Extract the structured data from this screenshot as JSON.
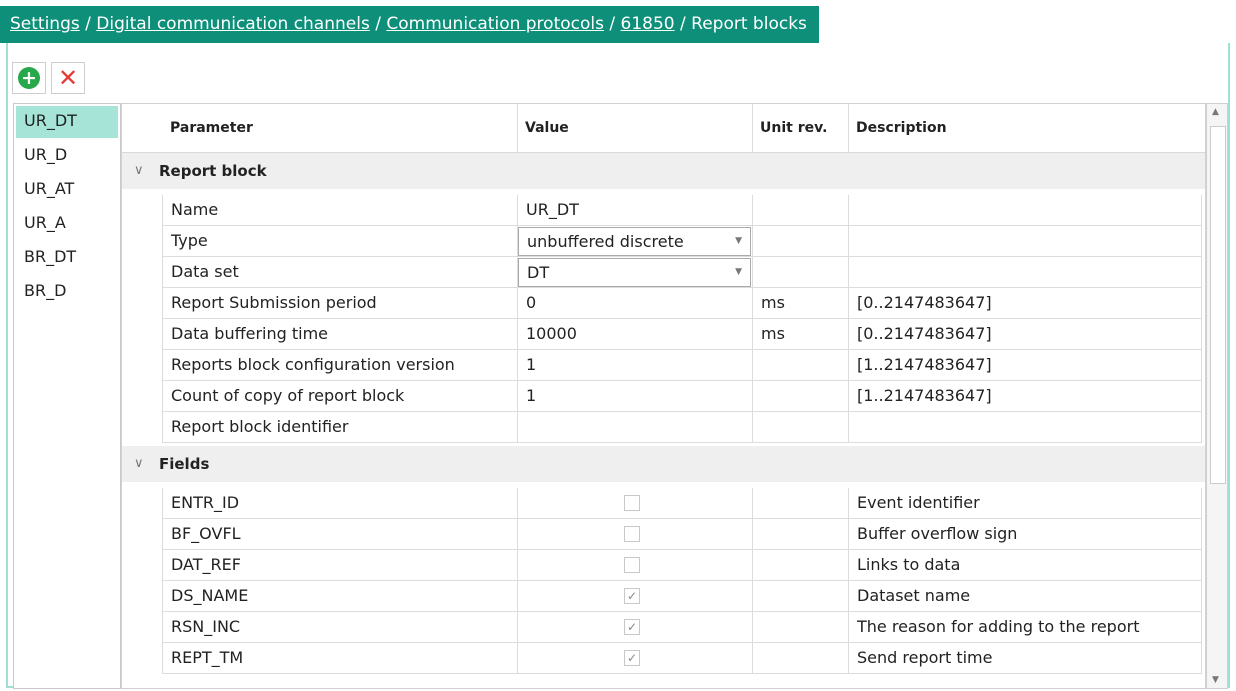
{
  "breadcrumb": {
    "items": [
      "Settings",
      "Digital communication channels",
      "Communication protocols",
      "61850"
    ],
    "separator": "/",
    "current": "Report blocks"
  },
  "toolbar": {
    "add_icon": "plus-circle-icon",
    "delete_icon": "close-icon"
  },
  "blocks": [
    "UR_DT",
    "UR_D",
    "UR_AT",
    "UR_A",
    "BR_DT",
    "BR_D"
  ],
  "selected_block": "UR_DT",
  "columns": [
    "Parameter",
    "Value",
    "Unit rev.",
    "Description"
  ],
  "report_block": {
    "title": "Report block",
    "rows": [
      {
        "param": "Name",
        "value": "UR_DT",
        "unit": "",
        "desc": ""
      },
      {
        "param": "Type",
        "value": "unbuffered discrete",
        "unit": "",
        "desc": ""
      },
      {
        "param": "Data set",
        "value": "DT",
        "unit": "",
        "desc": ""
      },
      {
        "param": "Report Submission period",
        "value": "0",
        "unit": "ms",
        "desc": "[0..2147483647]"
      },
      {
        "param": "Data buffering time",
        "value": "10000",
        "unit": "ms",
        "desc": "[0..2147483647]"
      },
      {
        "param": "Reports block configuration version",
        "value": "1",
        "unit": "",
        "desc": "[1..2147483647]"
      },
      {
        "param": "Count of copy of report block",
        "value": "1",
        "unit": "",
        "desc": "[1..2147483647]"
      },
      {
        "param": "Report block identifier",
        "value": "",
        "unit": "",
        "desc": ""
      }
    ]
  },
  "fields": {
    "title": "Fields",
    "rows": [
      {
        "param": "ENTR_ID",
        "checked": false,
        "desc": "Event identifier"
      },
      {
        "param": "BF_OVFL",
        "checked": false,
        "desc": "Buffer overflow sign"
      },
      {
        "param": "DAT_REF",
        "checked": false,
        "desc": "Links to data"
      },
      {
        "param": "DS_NAME",
        "checked": true,
        "desc": "Dataset name"
      },
      {
        "param": "RSN_INC",
        "checked": true,
        "desc": "The reason for adding to the report"
      },
      {
        "param": "REPT_TM",
        "checked": true,
        "desc": "Send report time"
      }
    ]
  },
  "colors": {
    "accent": "#0e8f7a",
    "selection": "#a6e4d8",
    "border": "#9ee0d2"
  }
}
